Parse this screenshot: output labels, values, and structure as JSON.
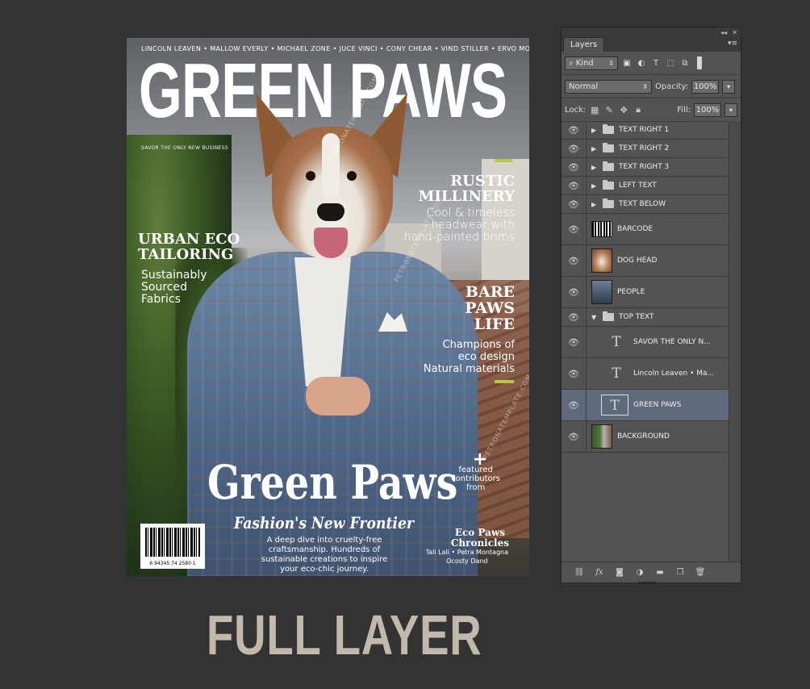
{
  "cover": {
    "names_line": "LINCOLN LEAVEN • MALLOW EVERLY • MICHAEL ZONE • JUCE VINCI • CONY CHEAR • VIND STILLER • ERVO MORE",
    "masthead": "GREEN PAWS",
    "savor_line": "SAVOR THE ONLY NEW BUSINESS",
    "rustic_title": [
      "RUSTIC",
      "MILLINERY"
    ],
    "rustic_sub": [
      "Cool & timeless",
      "headwear with",
      "hand-painted brims"
    ],
    "urban_title": [
      "URBAN ECO",
      "TAILORING"
    ],
    "urban_sub": [
      "Sustainably",
      "Sourced",
      "Fabrics"
    ],
    "bare_title": [
      "BARE",
      "PAWS",
      "LIFE"
    ],
    "bare_sub": [
      "Champions of",
      "eco design",
      "Natural materials"
    ],
    "plus": "+",
    "featured": [
      "featured",
      "contributors",
      "from"
    ],
    "big_title": "Green Paws",
    "subtitle": "Fashion's New Frontier",
    "deep_dive": "A deep dive into cruelty-free craftsmanship. Hundreds of sustainable creations to inspire your eco-chic journey.",
    "chronicles_title": [
      "Eco Paws",
      "Chronicles"
    ],
    "chronicles_sub": [
      "Tali Lali • Petra Montagna",
      "Ocosty Dand"
    ],
    "barcode_number": "6 94345 74 2580 1",
    "watermark": "PETRONATEMPLATE.COM",
    "accent_color": "#b7c93a"
  },
  "caption": "FULL LAYER",
  "panel": {
    "tab": "Layers",
    "filter_kind": "Kind",
    "blend_mode": "Normal",
    "opacity_label": "Opacity:",
    "opacity_value": "100%",
    "lock_label": "Lock:",
    "fill_label": "Fill:",
    "fill_value": "100%",
    "layers": [
      {
        "name": "TEXT RIGHT 1",
        "type": "group-collapsed"
      },
      {
        "name": "TEXT RIGHT 2",
        "type": "group-collapsed"
      },
      {
        "name": "TEXT RIGHT 3",
        "type": "group-collapsed"
      },
      {
        "name": "LEFT TEXT",
        "type": "group-collapsed"
      },
      {
        "name": "TEXT BELOW",
        "type": "group-collapsed"
      },
      {
        "name": "BARCODE",
        "type": "image"
      },
      {
        "name": "DOG HEAD",
        "type": "image"
      },
      {
        "name": "PEOPLE",
        "type": "image"
      },
      {
        "name": "TOP TEXT",
        "type": "group-expanded"
      },
      {
        "name": "SAVOR THE ONLY N...",
        "type": "text"
      },
      {
        "name": "Lincoln Leaven • Ma...",
        "type": "text"
      },
      {
        "name": "GREEN PAWS",
        "type": "text",
        "selected": true
      },
      {
        "name": "BACKGROUND",
        "type": "image"
      }
    ],
    "footer_icons": [
      "link-icon",
      "fx-icon",
      "mask-icon",
      "adjustment-icon",
      "folder-icon",
      "new-layer-icon",
      "trash-icon"
    ]
  }
}
